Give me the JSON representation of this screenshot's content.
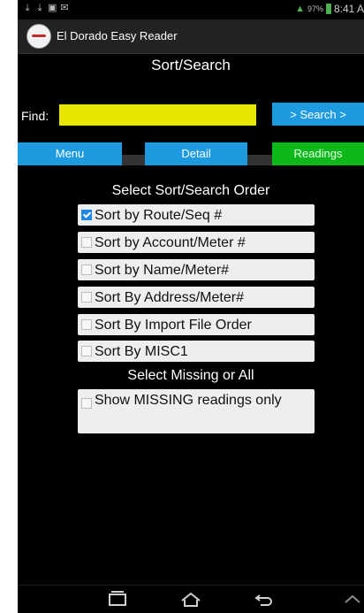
{
  "status_bar": {
    "left_icons": [
      "download-icon",
      "download-icon",
      "image-icon",
      "mail-icon"
    ],
    "battery": "97%",
    "time": "8:41 A"
  },
  "app": {
    "title": "El Dorado Easy Reader"
  },
  "screen": {
    "title": "Sort/Search"
  },
  "find": {
    "label": "Find:",
    "value": "",
    "placeholder": "",
    "search_button": "> Search >"
  },
  "nav_buttons": {
    "menu": "Menu",
    "detail": "Detail",
    "readings": "Readings"
  },
  "sort_section": {
    "title": "Select Sort/Search Order",
    "options": [
      {
        "label": "Sort by Route/Seq #",
        "checked": true
      },
      {
        "label": "Sort by Account/Meter #",
        "checked": false
      },
      {
        "label": "Sort by Name/Meter#",
        "checked": false
      },
      {
        "label": "Sort By Address/Meter#",
        "checked": false
      },
      {
        "label": "Sort By Import File Order",
        "checked": false
      },
      {
        "label": "Sort By MISC1",
        "checked": false
      }
    ]
  },
  "missing_section": {
    "title": "Select Missing or All",
    "option": {
      "label": "Show MISSING readings only",
      "checked": false
    }
  },
  "colors": {
    "accent_blue": "#1e9ae0",
    "readings_green": "#0fb81a",
    "find_yellow": "#e6e600",
    "background": "#000000"
  }
}
